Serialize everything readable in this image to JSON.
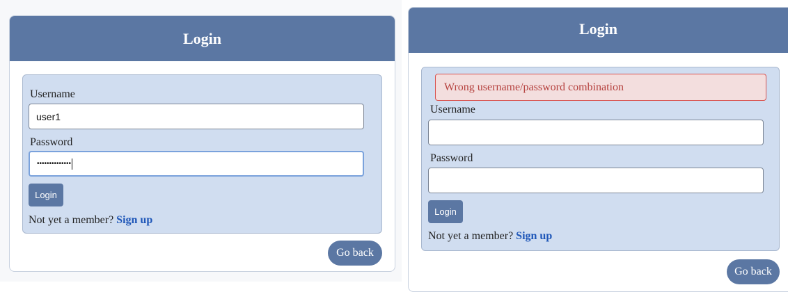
{
  "left_panel": {
    "header_title": "Login",
    "username_label": "Username",
    "username_value": "user1",
    "password_label": "Password",
    "password_value": "••••••••••••••",
    "login_button": "Login",
    "signup_prompt": "Not yet a member?",
    "signup_link": "Sign up",
    "go_back_button": "Go back"
  },
  "right_panel": {
    "header_title": "Login",
    "error_message": "Wrong username/password combination",
    "username_label": "Username",
    "username_value": "",
    "password_label": "Password",
    "password_value": "",
    "login_button": "Login",
    "signup_prompt": "Not yet a member?",
    "signup_link": "Sign up",
    "go_back_button": "Go back"
  },
  "colors": {
    "header": "#5b77a3",
    "panel": "#d0ddf0",
    "link": "#1e56b8",
    "error_bg": "#f3dede",
    "error_text": "#b5413e"
  }
}
